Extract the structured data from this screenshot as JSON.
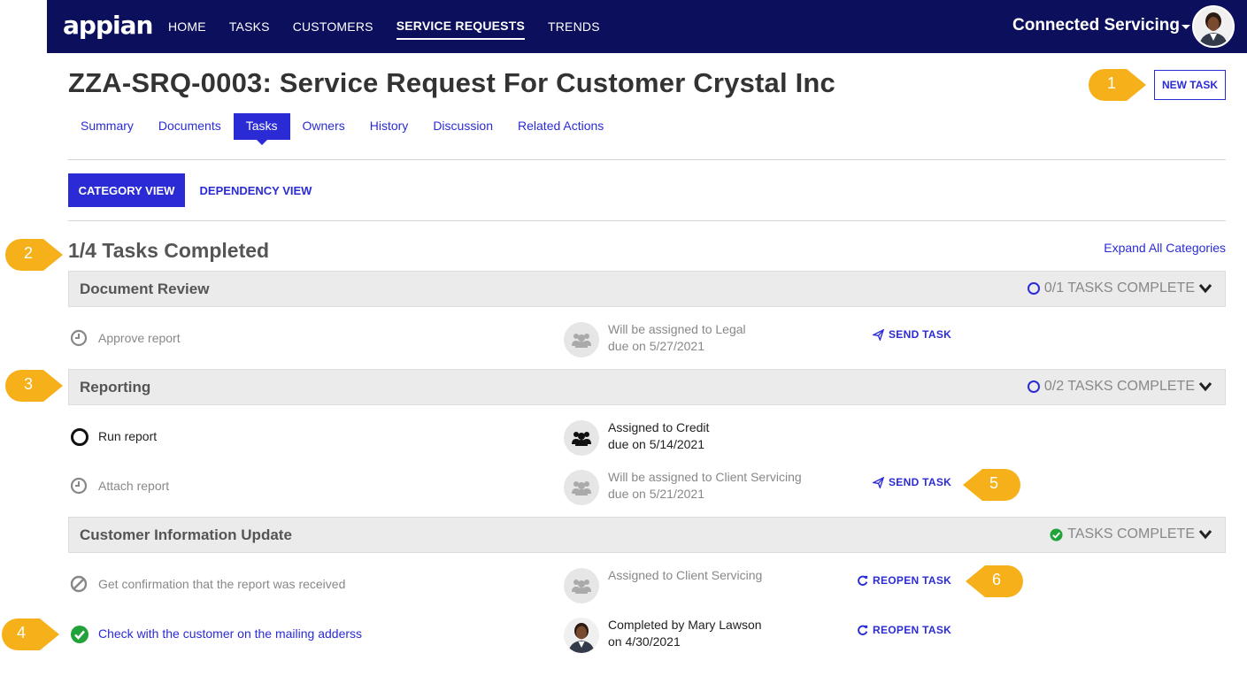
{
  "header": {
    "logo": "appian",
    "nav": [
      "HOME",
      "TASKS",
      "CUSTOMERS",
      "SERVICE REQUESTS",
      "TRENDS"
    ],
    "active_nav": "SERVICE REQUESTS",
    "site_name": "Connected Servicing"
  },
  "page": {
    "title": "ZZA-SRQ-0003: Service Request For Customer Crystal Inc",
    "new_task_label": "NEW TASK"
  },
  "tabs": [
    "Summary",
    "Documents",
    "Tasks",
    "Owners",
    "History",
    "Discussion",
    "Related Actions"
  ],
  "active_tab": "Tasks",
  "views": {
    "category": "CATEGORY VIEW",
    "dependency": "DEPENDENCY VIEW"
  },
  "summary": {
    "completed_text": "1/4 Tasks Completed",
    "expand_all": "Expand All Categories"
  },
  "categories": [
    {
      "name": "Document Review",
      "status": "0/1 TASKS COMPLETE",
      "tasks": [
        {
          "name": "Approve report",
          "status_icon": "clock-icon",
          "assign_line1": "Will be assigned to Legal",
          "assign_line2": "due on 5/27/2021",
          "action": "SEND TASK",
          "action_icon": "send-icon"
        }
      ]
    },
    {
      "name": "Reporting",
      "status": "0/2 TASKS COMPLETE",
      "tasks": [
        {
          "name": "Run report",
          "status_icon": "open-circle-icon",
          "assign_line1": "Assigned to Credit",
          "assign_line2": "due on 5/14/2021",
          "action": ""
        },
        {
          "name": "Attach report",
          "status_icon": "clock-icon",
          "assign_line1": "Will be assigned to Client Servicing",
          "assign_line2": "due on 5/21/2021",
          "action": "SEND TASK",
          "action_icon": "send-icon"
        }
      ]
    },
    {
      "name": "Customer Information Update",
      "status": "TASKS COMPLETE",
      "tasks": [
        {
          "name": "Get confirmation that the report was received",
          "status_icon": "cancelled-icon",
          "assign_line1": "Assigned to Client Servicing",
          "assign_line2": "",
          "action": "REOPEN TASK",
          "action_icon": "reopen-icon"
        },
        {
          "name": "Check with the customer on the mailing adderss",
          "status_icon": "check-circle-icon",
          "assign_line1": "Completed by Mary Lawson",
          "assign_line2": "on 4/30/2021",
          "action": "REOPEN TASK",
          "action_icon": "reopen-icon"
        }
      ]
    }
  ],
  "callouts": [
    "1",
    "2",
    "3",
    "4",
    "5",
    "6"
  ],
  "colors": {
    "nav_bg": "#0b0f5c",
    "accent": "#2b2bd6",
    "callout": "#f5b01a",
    "complete_green": "#22a33a"
  }
}
